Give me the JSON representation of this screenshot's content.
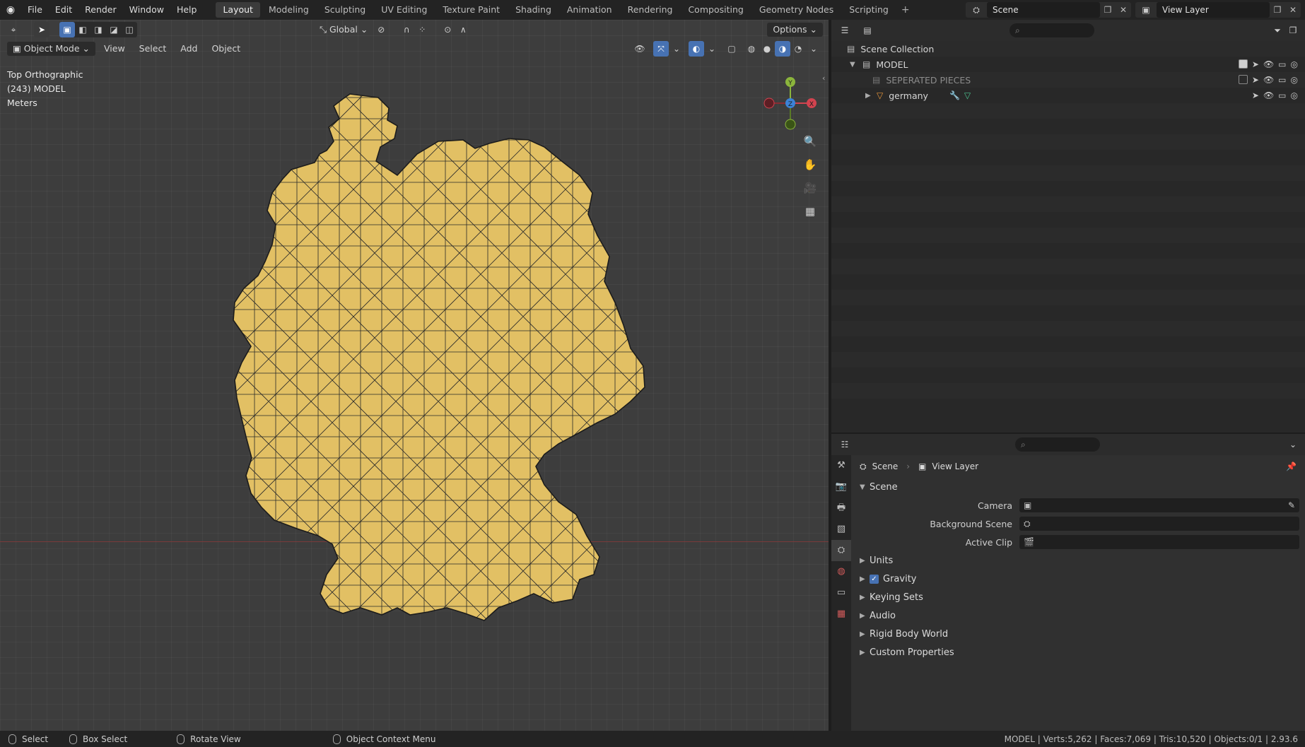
{
  "menu": {
    "items": [
      "File",
      "Edit",
      "Render",
      "Window",
      "Help"
    ]
  },
  "workspaces": {
    "tabs": [
      "Layout",
      "Modeling",
      "Sculpting",
      "UV Editing",
      "Texture Paint",
      "Shading",
      "Animation",
      "Rendering",
      "Compositing",
      "Geometry Nodes",
      "Scripting"
    ],
    "active": "Layout"
  },
  "topbar": {
    "scene_name": "Scene",
    "view_layer": "View Layer"
  },
  "viewport": {
    "transform_orientation": "Global",
    "options_label": "Options",
    "mode": "Object Mode",
    "menus": [
      "View",
      "Select",
      "Add",
      "Object"
    ],
    "overlay_lines": [
      "Top Orthographic",
      "(243) MODEL",
      "Meters"
    ],
    "gizmo_axes": {
      "x": "X",
      "y": "Y",
      "z": "Z"
    },
    "mesh_color": "#e2c064",
    "xaxis_color": "#7a3a3a"
  },
  "outliner": {
    "root": "Scene Collection",
    "rows": [
      {
        "label": "MODEL",
        "type": "collection",
        "checked": true
      },
      {
        "label": "SEPERATED PIECES",
        "type": "collection",
        "checked": false,
        "dim": true
      },
      {
        "label": "germany",
        "type": "mesh"
      }
    ]
  },
  "properties": {
    "breadcrumb_scene": "Scene",
    "breadcrumb_view_layer": "View Layer",
    "panel_title": "Scene",
    "fields": [
      {
        "label": "Camera"
      },
      {
        "label": "Background Scene"
      },
      {
        "label": "Active Clip"
      }
    ],
    "subpanels": [
      "Units",
      "Gravity",
      "Keying Sets",
      "Audio",
      "Rigid Body World",
      "Custom Properties"
    ],
    "gravity_checked": true
  },
  "statusbar": {
    "select": "Select",
    "box_select": "Box Select",
    "rotate_view": "Rotate View",
    "context_menu": "Object Context Menu",
    "stats": "MODEL | Verts:5,262 | Faces:7,069 | Tris:10,520 | Objects:0/1 | 2.93.6"
  }
}
